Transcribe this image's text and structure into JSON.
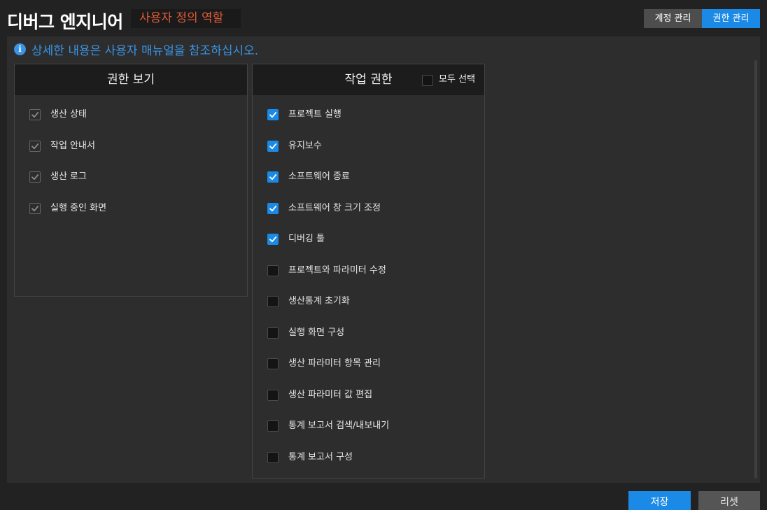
{
  "header": {
    "title": "디버그 엔지니어",
    "role": "사용자 정의 역할",
    "tabs": [
      "계정 관리",
      "권한 관리"
    ],
    "active_tab": "권한 관리"
  },
  "info": {
    "icon": "info-icon",
    "text": "상세한 내용은 사용자 매뉴얼을 참조하십시오."
  },
  "view_panel": {
    "title": "권한 보기",
    "items": [
      {
        "label": "생산 상태",
        "checked": true,
        "disabled": true
      },
      {
        "label": "작업 안내서",
        "checked": true,
        "disabled": true
      },
      {
        "label": "생산 로그",
        "checked": true,
        "disabled": true
      },
      {
        "label": "실행 중인 화면",
        "checked": true,
        "disabled": true
      }
    ]
  },
  "work_panel": {
    "title": "작업 권한",
    "select_all_label": "모두 선택",
    "select_all_checked": false,
    "items": [
      {
        "label": "프로젝트 실행",
        "checked": true
      },
      {
        "label": "유지보수",
        "checked": true
      },
      {
        "label": "소프트웨어 종료",
        "checked": true
      },
      {
        "label": "소프트웨어 창 크기 조정",
        "checked": true
      },
      {
        "label": "디버깅 툴",
        "checked": true
      },
      {
        "label": "프로젝트와 파라미터 수정",
        "checked": false
      },
      {
        "label": "생산통계 초기화",
        "checked": false
      },
      {
        "label": "실행 화면 구성",
        "checked": false
      },
      {
        "label": "생산 파라미터 항목 관리",
        "checked": false
      },
      {
        "label": "생산 파라미터 값 편집",
        "checked": false
      },
      {
        "label": "통계 보고서 검색/내보내기",
        "checked": false
      },
      {
        "label": "통계 보고서 구성",
        "checked": false
      }
    ]
  },
  "buttons": {
    "save": "저장",
    "reset": "리셋"
  },
  "colors": {
    "accent": "#1a8ae6",
    "role_text": "#e05a3a",
    "info_text": "#3a94e6"
  }
}
